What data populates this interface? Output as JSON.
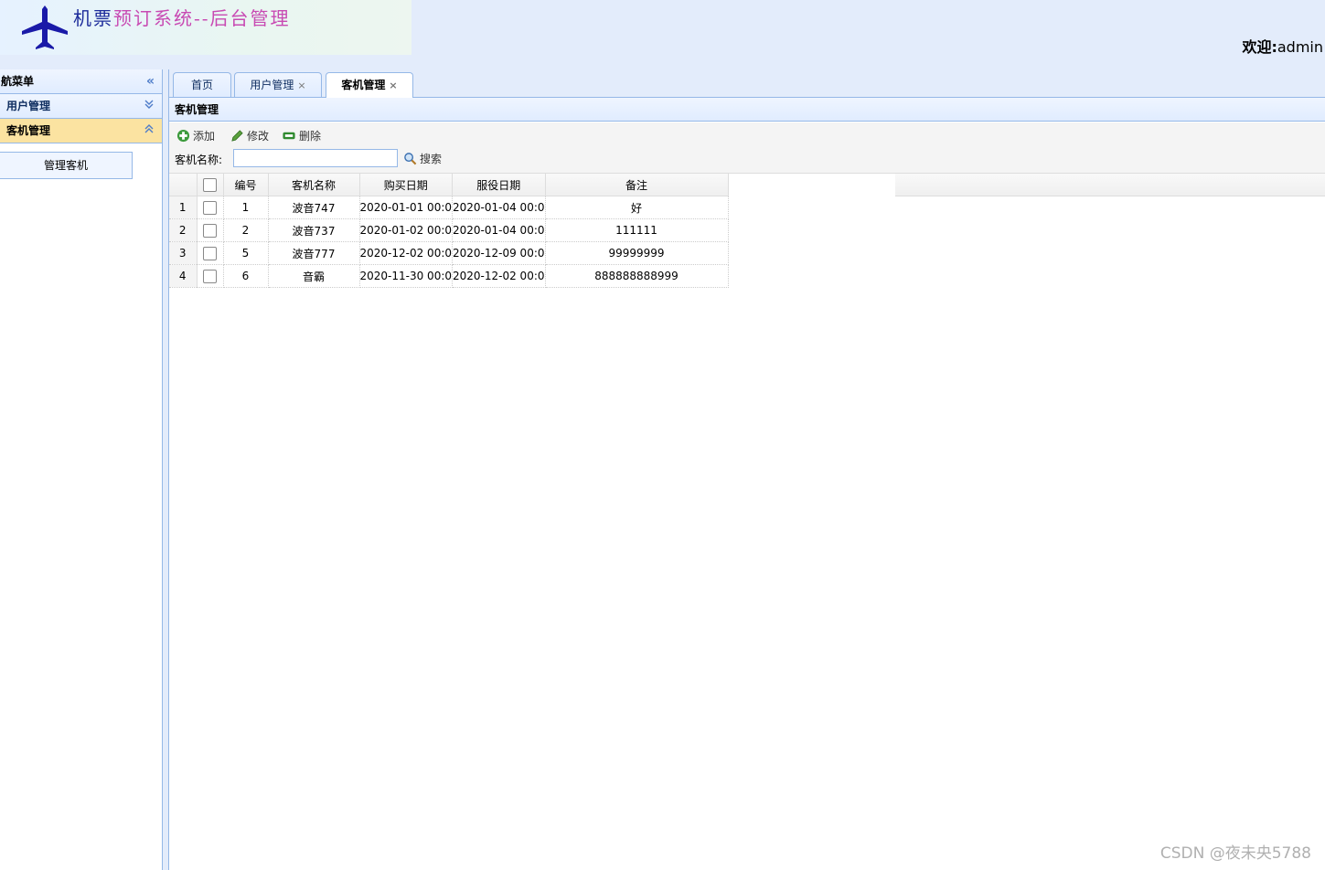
{
  "header": {
    "title_part1": "机票",
    "title_part2": "预订系统--后台管理",
    "welcome_label": "欢迎:",
    "username": "admin"
  },
  "leftnav": {
    "title": "航菜单",
    "collapse_icon": "«",
    "sections": [
      {
        "label": "用户管理",
        "icon": "expand-down"
      },
      {
        "label": "客机管理",
        "icon": "collapse-up"
      }
    ],
    "links": [
      {
        "label": "管理客机"
      }
    ]
  },
  "tabs": [
    {
      "label": "首页",
      "closable": false
    },
    {
      "label": "用户管理",
      "closable": true
    },
    {
      "label": "客机管理",
      "closable": true
    }
  ],
  "tab_close_glyph": "×",
  "panel": {
    "title": "客机管理"
  },
  "toolbar": {
    "add_label": "添加",
    "edit_label": "修改",
    "delete_label": "删除",
    "search_label": "客机名称:",
    "search_value": "",
    "search_button": "搜索"
  },
  "grid": {
    "columns": [
      "编号",
      "客机名称",
      "购买日期",
      "服役日期",
      "备注"
    ],
    "rows": [
      {
        "rownum": "1",
        "id": "1",
        "name": "波音747",
        "buy_date": "2020-01-01 00:0",
        "service_date": "2020-01-04 00:0",
        "note": "好"
      },
      {
        "rownum": "2",
        "id": "2",
        "name": "波音737",
        "buy_date": "2020-01-02 00:0",
        "service_date": "2020-01-04 00:0",
        "note": "111111"
      },
      {
        "rownum": "3",
        "id": "5",
        "name": "波音777",
        "buy_date": "2020-12-02 00:0",
        "service_date": "2020-12-09 00:0",
        "note": "99999999"
      },
      {
        "rownum": "4",
        "id": "6",
        "name": "音霸",
        "buy_date": "2020-11-30 00:0",
        "service_date": "2020-12-02 00:0",
        "note": "888888888999"
      }
    ]
  },
  "watermark": "CSDN @夜未央5788",
  "colors": {
    "header_bg": "#e3ecfb",
    "border": "#95b8e7",
    "selected_section": "#fbe3a1",
    "plane": "#1a1aa8",
    "title_blue": "#1b2a9a",
    "title_pink": "#c84ab3"
  }
}
